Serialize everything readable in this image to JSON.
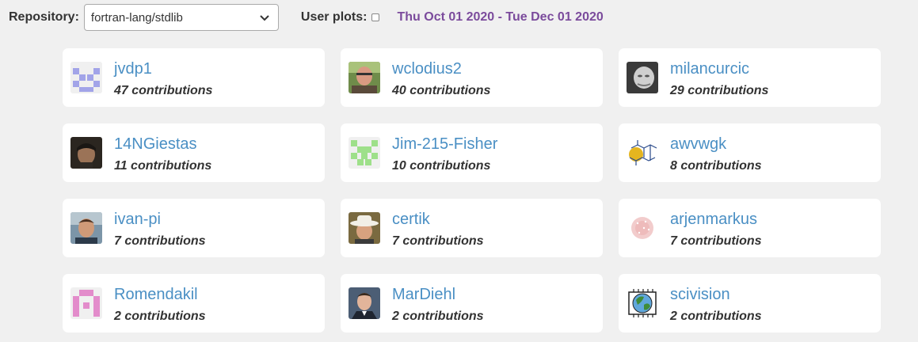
{
  "toolbar": {
    "repo_label": "Repository:",
    "repo_value": "fortran-lang/stdlib",
    "user_plots_label": "User plots:",
    "date_range": "Thu Oct 01 2020 - Tue Dec 01 2020",
    "date_range_color": "#7b4b9c"
  },
  "link_color": "#4a8fc4",
  "contributors": [
    {
      "username": "jvdp1",
      "contributions": "47 contributions",
      "avatar": "identicon-purple"
    },
    {
      "username": "wclodius2",
      "contributions": "40 contributions",
      "avatar": "photo-older-man"
    },
    {
      "username": "milancurcic",
      "contributions": "29 contributions",
      "avatar": "photo-bw-portrait"
    },
    {
      "username": "14NGiestas",
      "contributions": "11 contributions",
      "avatar": "photo-dark-portrait"
    },
    {
      "username": "Jim-215-Fisher",
      "contributions": "10 contributions",
      "avatar": "identicon-green"
    },
    {
      "username": "awvwgk",
      "contributions": "8 contributions",
      "avatar": "molecule-drawing"
    },
    {
      "username": "ivan-pi",
      "contributions": "7 contributions",
      "avatar": "photo-portrait"
    },
    {
      "username": "certik",
      "contributions": "7 contributions",
      "avatar": "photo-cowboy-hat"
    },
    {
      "username": "arjenmarkus",
      "contributions": "7 contributions",
      "avatar": "pink-dot-pattern"
    },
    {
      "username": "Romendakil",
      "contributions": "2 contributions",
      "avatar": "identicon-pink"
    },
    {
      "username": "MarDiehl",
      "contributions": "2 contributions",
      "avatar": "photo-suit-portrait"
    },
    {
      "username": "scivision",
      "contributions": "2 contributions",
      "avatar": "globe-chip"
    }
  ]
}
